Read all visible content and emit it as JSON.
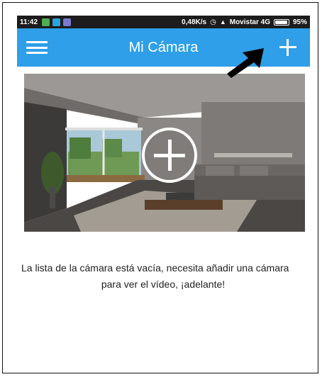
{
  "status_bar": {
    "time": "11:42",
    "network_speed": "0,48K/s",
    "carrier": "Movistar 4G",
    "battery": "95%",
    "battery_level": 0.95
  },
  "app_bar": {
    "title": "Mi Cámara",
    "menu_icon": "hamburger-menu-icon",
    "add_icon": "plus-icon"
  },
  "banner": {
    "add_icon": "circle-plus-icon"
  },
  "empty_state": {
    "line1": "La lista de la cámara está vacía, necesita añadir una cámara",
    "line2": "para ver el vídeo, ¡adelante!"
  },
  "colors": {
    "app_bar": "#2e9fe8",
    "status_bar": "#1c1c1c",
    "text": "#222222"
  }
}
